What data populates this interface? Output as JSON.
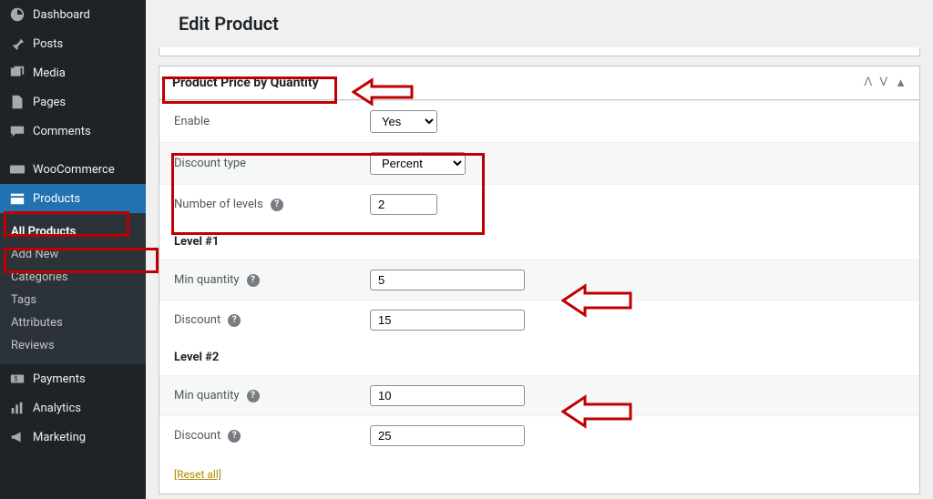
{
  "sidebar": {
    "items": [
      {
        "label": "Dashboard"
      },
      {
        "label": "Posts"
      },
      {
        "label": "Media"
      },
      {
        "label": "Pages"
      },
      {
        "label": "Comments"
      },
      {
        "label": "WooCommerce"
      },
      {
        "label": "Products"
      },
      {
        "label": "Payments"
      },
      {
        "label": "Analytics"
      },
      {
        "label": "Marketing"
      }
    ],
    "sub_products": [
      {
        "label": "All Products"
      },
      {
        "label": "Add New"
      },
      {
        "label": "Categories"
      },
      {
        "label": "Tags"
      },
      {
        "label": "Attributes"
      },
      {
        "label": "Reviews"
      }
    ]
  },
  "page": {
    "title": "Edit Product"
  },
  "panel": {
    "title": "Product Price by Quantity",
    "enable_label": "Enable",
    "enable_value": "Yes",
    "discount_type_label": "Discount type",
    "discount_type_value": "Percent",
    "levels_label": "Number of levels",
    "levels_value": "2",
    "level1_title": "Level #1",
    "level2_title": "Level #2",
    "min_qty_label": "Min quantity",
    "discount_label": "Discount",
    "l1_min_qty": "5",
    "l1_discount": "15",
    "l2_min_qty": "10",
    "l2_discount": "25",
    "reset": "[Reset all]"
  }
}
